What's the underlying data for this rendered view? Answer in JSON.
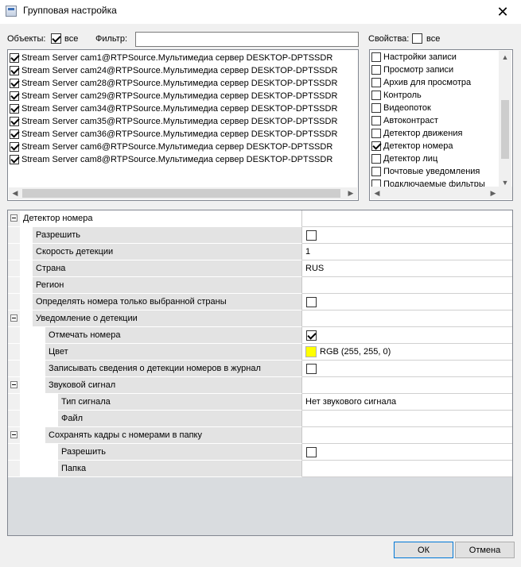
{
  "window": {
    "title": "Групповая настройка",
    "close_glyph": "✕"
  },
  "objects": {
    "label": "Объекты:",
    "all_label": "все",
    "all_checked": true,
    "filter_label": "Фильтр:",
    "filter_value": "",
    "items": [
      {
        "label": "Stream Server cam1@RTPSource.Мультимедиа сервер DESKTOP-DPTSSDR",
        "checked": true
      },
      {
        "label": "Stream Server cam24@RTPSource.Мультимедиа сервер DESKTOP-DPTSSDR",
        "checked": true
      },
      {
        "label": "Stream Server cam28@RTPSource.Мультимедиа сервер DESKTOP-DPTSSDR",
        "checked": true
      },
      {
        "label": "Stream Server cam29@RTPSource.Мультимедиа сервер DESKTOP-DPTSSDR",
        "checked": true
      },
      {
        "label": "Stream Server cam34@RTPSource.Мультимедиа сервер DESKTOP-DPTSSDR",
        "checked": true
      },
      {
        "label": "Stream Server cam35@RTPSource.Мультимедиа сервер DESKTOP-DPTSSDR",
        "checked": true
      },
      {
        "label": "Stream Server cam36@RTPSource.Мультимедиа сервер DESKTOP-DPTSSDR",
        "checked": true
      },
      {
        "label": "Stream Server cam6@RTPSource.Мультимедиа сервер DESKTOP-DPTSSDR",
        "checked": true
      },
      {
        "label": "Stream Server cam8@RTPSource.Мультимедиа сервер DESKTOP-DPTSSDR",
        "checked": true
      }
    ]
  },
  "properties": {
    "label": "Свойства:",
    "all_label": "все",
    "all_checked": false,
    "items": [
      {
        "label": "Настройки записи",
        "checked": false
      },
      {
        "label": "Просмотр записи",
        "checked": false
      },
      {
        "label": "Архив для просмотра",
        "checked": false
      },
      {
        "label": "Контроль",
        "checked": false
      },
      {
        "label": "Видеопоток",
        "checked": false
      },
      {
        "label": "Автоконтраст",
        "checked": false
      },
      {
        "label": "Детектор движения",
        "checked": false
      },
      {
        "label": "Детектор номера",
        "checked": true
      },
      {
        "label": "Детектор лиц",
        "checked": false
      },
      {
        "label": "Почтовые уведомления",
        "checked": false
      },
      {
        "label": "Подключаемые фильтры",
        "checked": false
      }
    ]
  },
  "grid": {
    "rows": [
      {
        "name": "Детектор номера",
        "level": 0,
        "category": true,
        "value": "",
        "checkbox": null
      },
      {
        "name": "Разрешить",
        "level": 1,
        "category": false,
        "value": "",
        "checkbox": false
      },
      {
        "name": "Скорость детекции",
        "level": 1,
        "category": false,
        "value": "1",
        "checkbox": null
      },
      {
        "name": "Страна",
        "level": 1,
        "category": false,
        "value": "RUS",
        "checkbox": null
      },
      {
        "name": "Регион",
        "level": 1,
        "category": false,
        "value": "",
        "checkbox": null
      },
      {
        "name": "Определять номера только выбранной страны",
        "level": 1,
        "category": false,
        "value": "",
        "checkbox": false
      },
      {
        "name": "Уведомление о детекции",
        "level": 1,
        "category": true,
        "value": "",
        "checkbox": null
      },
      {
        "name": "Отмечать номера",
        "level": 2,
        "category": false,
        "value": "",
        "checkbox": true
      },
      {
        "name": "Цвет",
        "level": 2,
        "category": false,
        "value": "RGB (255, 255, 0)",
        "checkbox": null,
        "color": "#ffff00"
      },
      {
        "name": "Записывать сведения о детекции номеров в журнал",
        "level": 2,
        "category": false,
        "value": "",
        "checkbox": false
      },
      {
        "name": "Звуковой сигнал",
        "level": 2,
        "category": true,
        "value": "",
        "checkbox": null
      },
      {
        "name": "Тип сигнала",
        "level": 3,
        "category": false,
        "value": "Нет звукового сигнала",
        "checkbox": null
      },
      {
        "name": "Файл",
        "level": 3,
        "category": false,
        "value": "",
        "checkbox": null
      },
      {
        "name": "Сохранять кадры с номерами в папку",
        "level": 2,
        "category": true,
        "value": "",
        "checkbox": null
      },
      {
        "name": "Разрешить",
        "level": 3,
        "category": false,
        "value": "",
        "checkbox": false
      },
      {
        "name": "Папка",
        "level": 3,
        "category": false,
        "value": "",
        "checkbox": null
      }
    ]
  },
  "buttons": {
    "ok": "ОК",
    "cancel": "Отмена"
  }
}
